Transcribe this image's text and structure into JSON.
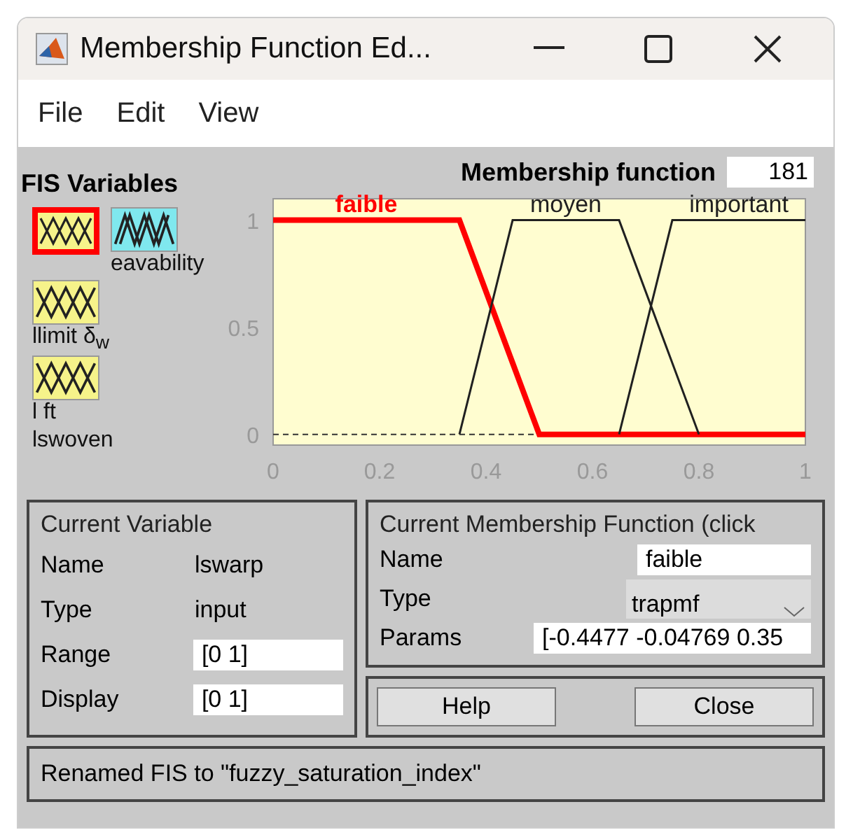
{
  "window": {
    "title": "Membership Function Ed..."
  },
  "menu": [
    {
      "label": "File"
    },
    {
      "label": "Edit"
    },
    {
      "label": "View"
    }
  ],
  "fis_variables": {
    "title": "FIS Variables",
    "variables": [
      {
        "kind": "input",
        "selected": true
      },
      {
        "kind": "output",
        "selected": false,
        "label": "eavability"
      },
      {
        "kind": "input",
        "selected": false,
        "label": "llimit δ$_{w}$"
      },
      {
        "kind": "input",
        "selected": false,
        "label": "l ft"
      },
      {
        "kind": "none",
        "label": "lswoven"
      }
    ]
  },
  "plot": {
    "title": "Membership function",
    "points": "181",
    "chart_data": {
      "type": "line",
      "x": [
        0,
        0.35,
        0.45,
        0.5,
        0.65,
        0.75,
        0.8,
        1
      ],
      "xlim": [
        0,
        1
      ],
      "ylim": [
        -0.05,
        1.1
      ],
      "xticks": [
        0,
        0.2,
        0.4,
        0.6,
        0.8,
        1
      ],
      "yticks": [
        0,
        0.5,
        1
      ],
      "series": [
        {
          "name": "faible",
          "color": "#ff0000",
          "values": [
            1,
            1,
            0.333,
            0,
            0,
            0,
            0,
            0
          ]
        },
        {
          "name": "moyen",
          "color": "#202020",
          "values": [
            null,
            0,
            1,
            1,
            1,
            0.333,
            0,
            null
          ]
        },
        {
          "name": "important",
          "color": "#202020",
          "values": [
            null,
            null,
            null,
            null,
            0,
            1,
            1,
            1
          ]
        }
      ]
    },
    "curves": [
      {
        "selected": true
      },
      {
        "selected": false
      },
      {
        "selected": false
      }
    ]
  },
  "current_variable": {
    "title": "Current Variable",
    "rows": [
      {
        "label": "Name",
        "value": "lswarp",
        "kind": "text"
      },
      {
        "label": "Type",
        "value": "input",
        "kind": "text"
      },
      {
        "label": "Range",
        "value": "[0 1]",
        "kind": "field"
      },
      {
        "label": "Display",
        "value": "[0 1]",
        "kind": "field"
      }
    ]
  },
  "current_mf": {
    "title": "Current Membership Function (click",
    "name_label": "Name",
    "name": "faible",
    "type_label": "Type",
    "type": "trapmf",
    "params_label": "Params",
    "params": "[-0.4477 -0.04769 0.35"
  },
  "buttons": [
    {
      "label": "Help"
    },
    {
      "label": "Close"
    }
  ],
  "status_bar": "Renamed FIS to \"fuzzy_saturation_index\""
}
